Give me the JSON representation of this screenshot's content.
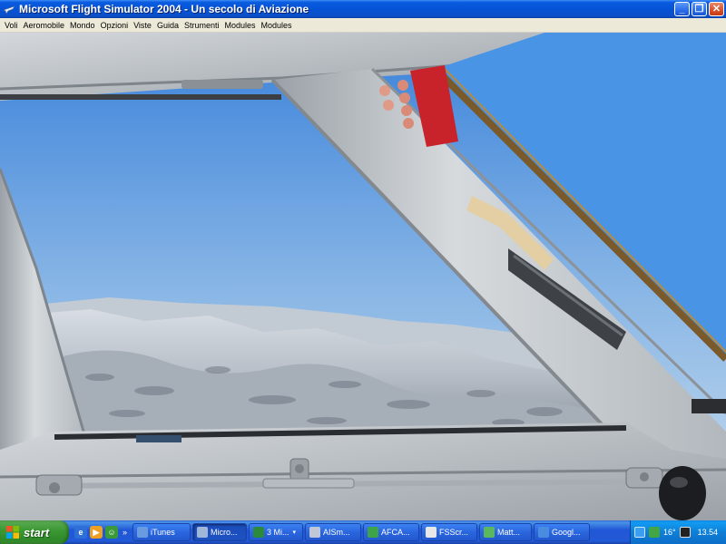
{
  "window": {
    "title": "Microsoft Flight Simulator 2004 - Un secolo di Aviazione",
    "controls": {
      "minimize": "_",
      "maximize": "❐",
      "close": "✕"
    }
  },
  "menu": {
    "items": [
      "Voli",
      "Aeromobile",
      "Mondo",
      "Opzioni",
      "Viste",
      "Guida",
      "Strumenti",
      "Modules",
      "Modules"
    ]
  },
  "taskbar": {
    "start_label": "start",
    "quick_launch": [
      "ie-icon",
      "media-icon",
      "messenger-icon"
    ],
    "quick_launch_more": "»",
    "tasks": [
      {
        "label": "iTunes",
        "icon": "itunes-icon",
        "color": "#6a9be0",
        "active": false
      },
      {
        "label": "Micro...",
        "icon": "fs-icon",
        "color": "#9fb6d8",
        "active": true
      },
      {
        "label": "3 Mi...",
        "icon": "excel-icon",
        "color": "#2d8a3a",
        "active": false,
        "caret": "▾"
      },
      {
        "label": "AISm...",
        "icon": "aism-icon",
        "color": "#c0c8d8",
        "active": false
      },
      {
        "label": "AFCA...",
        "icon": "afca-icon",
        "color": "#3fa34a",
        "active": false
      },
      {
        "label": "FSScr...",
        "icon": "fsscr-icon",
        "color": "#e8e8e8",
        "active": false
      },
      {
        "label": "Matt...",
        "icon": "matt-icon",
        "color": "#5cb85c",
        "active": false
      },
      {
        "label": "Googl...",
        "icon": "google-icon",
        "color": "#4a8de0",
        "active": false
      }
    ],
    "tray": {
      "temperature": "16°",
      "clock": "13.54"
    }
  },
  "colors": {
    "sky_top": "#3f86dc",
    "sky_bottom": "#bcd6ec",
    "frame": "#b6bcc2",
    "titlebar": "#0653d6",
    "taskbar": "#2259d6",
    "start": "#3c9a34"
  }
}
